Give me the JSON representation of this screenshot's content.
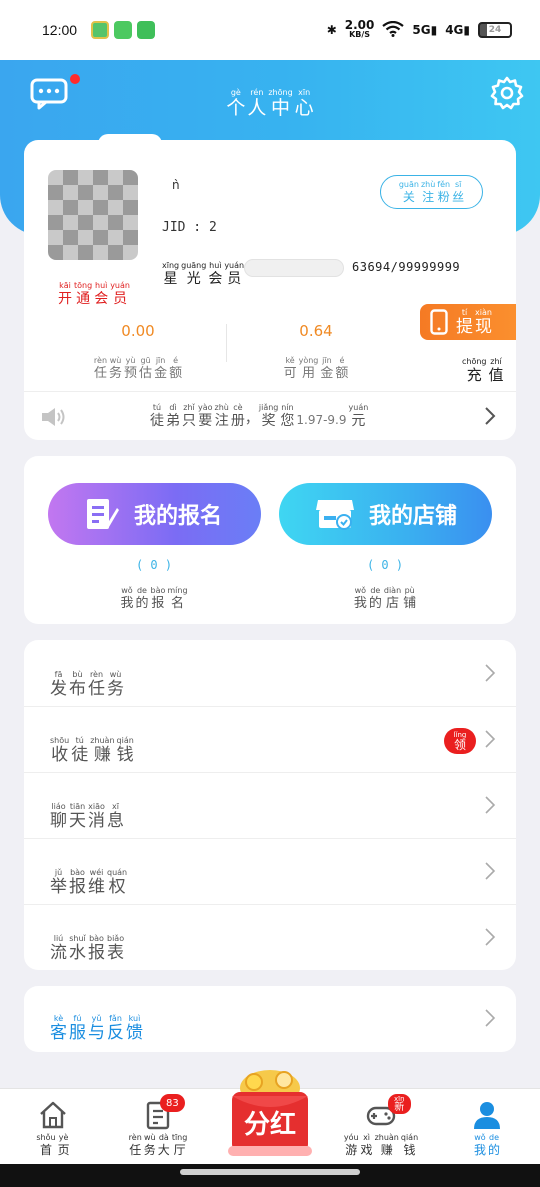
{
  "status_bar": {
    "time": "12:00",
    "speed": "2.00",
    "speed_unit": "KB/S",
    "battery": "24"
  },
  "header": {
    "title_chars": [
      {
        "py": "gè",
        "ch": "个"
      },
      {
        "py": "rén",
        "ch": "人"
      },
      {
        "py": "zhōng",
        "ch": "中"
      },
      {
        "py": "xīn",
        "ch": "心"
      }
    ]
  },
  "profile": {
    "nickname": "ǹ",
    "jid": "JID : 2",
    "avatar_caption": [
      {
        "py": "kāi",
        "ch": "开"
      },
      {
        "py": "tōng",
        "ch": "通"
      },
      {
        "py": "huì",
        "ch": "会"
      },
      {
        "py": "yuán",
        "ch": "员"
      }
    ],
    "follow_label": [
      {
        "py": "guān",
        "ch": "关"
      },
      {
        "py": "zhù",
        "ch": "注"
      },
      {
        "py": "fěn",
        "ch": "粉"
      },
      {
        "py": "sī",
        "ch": "丝"
      }
    ],
    "member_label": [
      {
        "py": "xīng",
        "ch": "星"
      },
      {
        "py": "guāng",
        "ch": "光"
      },
      {
        "py": "huì",
        "ch": "会"
      },
      {
        "py": "yuán",
        "ch": "员"
      }
    ],
    "points": "63694/99999999",
    "progress_fraction": 0.0006,
    "estimated_amount": "0.00",
    "estimated_label": [
      {
        "py": "rèn",
        "ch": "任"
      },
      {
        "py": "wù",
        "ch": "务"
      },
      {
        "py": "yù",
        "ch": "预"
      },
      {
        "py": "gū",
        "ch": "估"
      },
      {
        "py": "jīn",
        "ch": "金"
      },
      {
        "py": "é",
        "ch": "额"
      }
    ],
    "available_amount": "0.64",
    "available_label": [
      {
        "py": "kě",
        "ch": "可"
      },
      {
        "py": "yòng",
        "ch": "用"
      },
      {
        "py": "jīn",
        "ch": "金"
      },
      {
        "py": "é",
        "ch": "额"
      }
    ],
    "withdraw_label": [
      {
        "py": "tí",
        "ch": "提"
      },
      {
        "py": "xiàn",
        "ch": "现"
      }
    ],
    "recharge_label": [
      {
        "py": "chōng",
        "ch": "充"
      },
      {
        "py": "zhí",
        "ch": "值"
      }
    ],
    "notice_a": [
      {
        "py": "tú",
        "ch": "徒"
      },
      {
        "py": "dì",
        "ch": "弟"
      },
      {
        "py": "zhǐ",
        "ch": "只"
      },
      {
        "py": "yào",
        "ch": "要"
      },
      {
        "py": "zhù",
        "ch": "注"
      },
      {
        "py": "cè",
        "ch": "册"
      }
    ],
    "notice_sep": "，",
    "notice_b": [
      {
        "py": "jiǎng",
        "ch": "奖"
      },
      {
        "py": "nín",
        "ch": "您"
      }
    ],
    "notice_range": "1.97-9.9",
    "notice_c": [
      {
        "py": "yuán",
        "ch": "元"
      }
    ]
  },
  "actions": {
    "signup_btn": "我的报名",
    "shop_btn": "我的店铺",
    "signup_count": "( 0 )",
    "shop_count": "( 0 )",
    "signup_label": [
      {
        "py": "wǒ",
        "ch": "我"
      },
      {
        "py": "de",
        "ch": "的"
      },
      {
        "py": "bào",
        "ch": "报"
      },
      {
        "py": "míng",
        "ch": "名"
      }
    ],
    "shop_label": [
      {
        "py": "wǒ",
        "ch": "我"
      },
      {
        "py": "de",
        "ch": "的"
      },
      {
        "py": "diàn",
        "ch": "店"
      },
      {
        "py": "pù",
        "ch": "铺"
      }
    ]
  },
  "menu": [
    {
      "chars": [
        {
          "py": "fā",
          "ch": "发"
        },
        {
          "py": "bù",
          "ch": "布"
        },
        {
          "py": "rèn",
          "ch": "任"
        },
        {
          "py": "wù",
          "ch": "务"
        }
      ]
    },
    {
      "chars": [
        {
          "py": "shōu",
          "ch": "收"
        },
        {
          "py": "tú",
          "ch": "徒"
        },
        {
          "py": "zhuàn",
          "ch": "赚"
        },
        {
          "py": "qián",
          "ch": "钱"
        }
      ],
      "badge": {
        "py": "lǐng",
        "ch": "领"
      }
    },
    {
      "chars": [
        {
          "py": "liáo",
          "ch": "聊"
        },
        {
          "py": "tiān",
          "ch": "天"
        },
        {
          "py": "xiāo",
          "ch": "消"
        },
        {
          "py": "xī",
          "ch": "息"
        }
      ]
    },
    {
      "chars": [
        {
          "py": "jǔ",
          "ch": "举"
        },
        {
          "py": "bào",
          "ch": "报"
        },
        {
          "py": "wéi",
          "ch": "维"
        },
        {
          "py": "quán",
          "ch": "权"
        }
      ]
    },
    {
      "chars": [
        {
          "py": "liú",
          "ch": "流"
        },
        {
          "py": "shuǐ",
          "ch": "水"
        },
        {
          "py": "bào",
          "ch": "报"
        },
        {
          "py": "biǎo",
          "ch": "表"
        }
      ]
    }
  ],
  "service": [
    {
      "py": "kè",
      "ch": "客"
    },
    {
      "py": "fú",
      "ch": "服"
    },
    {
      "py": "yǔ",
      "ch": "与"
    },
    {
      "py": "fǎn",
      "ch": "反"
    },
    {
      "py": "kuì",
      "ch": "馈"
    }
  ],
  "nav": {
    "home": [
      {
        "py": "shǒu",
        "ch": "首"
      },
      {
        "py": "yè",
        "ch": "页"
      }
    ],
    "tasks": [
      {
        "py": "rèn",
        "ch": "任"
      },
      {
        "py": "wù",
        "ch": "务"
      },
      {
        "py": "dà",
        "ch": "大"
      },
      {
        "py": "tīng",
        "ch": "厅"
      }
    ],
    "tasks_badge": "83",
    "center_label": "分红",
    "games": [
      {
        "py": "yóu",
        "ch": "游"
      },
      {
        "py": "xì",
        "ch": "戏"
      },
      {
        "py": "zhuàn",
        "ch": "赚"
      },
      {
        "py": "qián",
        "ch": "钱"
      }
    ],
    "games_badge": {
      "py": "xīn",
      "ch": "新"
    },
    "mine": [
      {
        "py": "wǒ",
        "ch": "我"
      },
      {
        "py": "de",
        "ch": "的"
      }
    ]
  },
  "colors": {
    "accent": "#3bb3e6",
    "orange": "#f08a24",
    "red": "#ea1f1f",
    "active_nav": "#1b8ee0"
  }
}
